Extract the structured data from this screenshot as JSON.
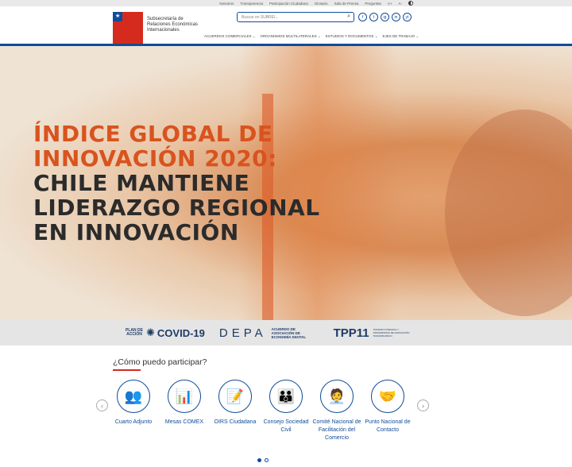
{
  "topbar": {
    "links": [
      "Nosotros",
      "Transparencia",
      "Participación Ciudadana",
      "Glosario",
      "Sala de Prensa",
      "Preguntas"
    ],
    "font_up": "A+",
    "font_down": "A-"
  },
  "header": {
    "brand": [
      "Subsecretaría de",
      "Relaciones Económicas",
      "Internacionales"
    ],
    "search_placeholder": "Buscar en SUBREI...",
    "social": [
      "f",
      "t",
      "ig",
      "in",
      "yt"
    ],
    "nav": [
      "ACUERDOS COMERCIALES",
      "ORGANISMOS MULTILATERALES",
      "ESTUDIOS Y DOCUMENTOS",
      "EJES DE TRABAJO"
    ]
  },
  "hero": {
    "line1": "ÍNDICE GLOBAL DE",
    "line2": "INNOVACIÓN 2020:",
    "line3": "CHILE MANTIENE",
    "line4": "LIDERAZGO REGIONAL",
    "line5": "EN INNOVACIÓN",
    "accent": "#d9531e"
  },
  "strip": {
    "covid_small": "PLAN DE ACCIÓN",
    "covid_big": "COVID-19",
    "depa_big": "DEPA",
    "depa_small": "ACUERDO DE ASOCIACIÓN DE ECONOMÍA DIGITAL",
    "tpp_big": "TPP11",
    "tpp_small": "TRATADO INTEGRAL Y PROGRESISTA DE ASOCIACIÓN TRANSPACÍFICO"
  },
  "participar": {
    "title": "¿Cómo puedo participar?",
    "items": [
      {
        "label": "Cuarto Adjunto",
        "icon": "👥"
      },
      {
        "label": "Mesas COMEX",
        "icon": "📊"
      },
      {
        "label": "OIRS Ciudadana",
        "icon": "📝"
      },
      {
        "label": "Consejo Sociedad Civil",
        "icon": "👪"
      },
      {
        "label": "Comité Nacional de Facilitación del Comercio",
        "icon": "🧑‍💼"
      },
      {
        "label": "Punto Nacional de Contacto",
        "icon": "🤝"
      }
    ],
    "prev": "‹",
    "next": "›",
    "pages": 2,
    "current_page": 1
  },
  "colors": {
    "brand_blue": "#0f4c9a",
    "brand_red": "#d52b1e"
  }
}
